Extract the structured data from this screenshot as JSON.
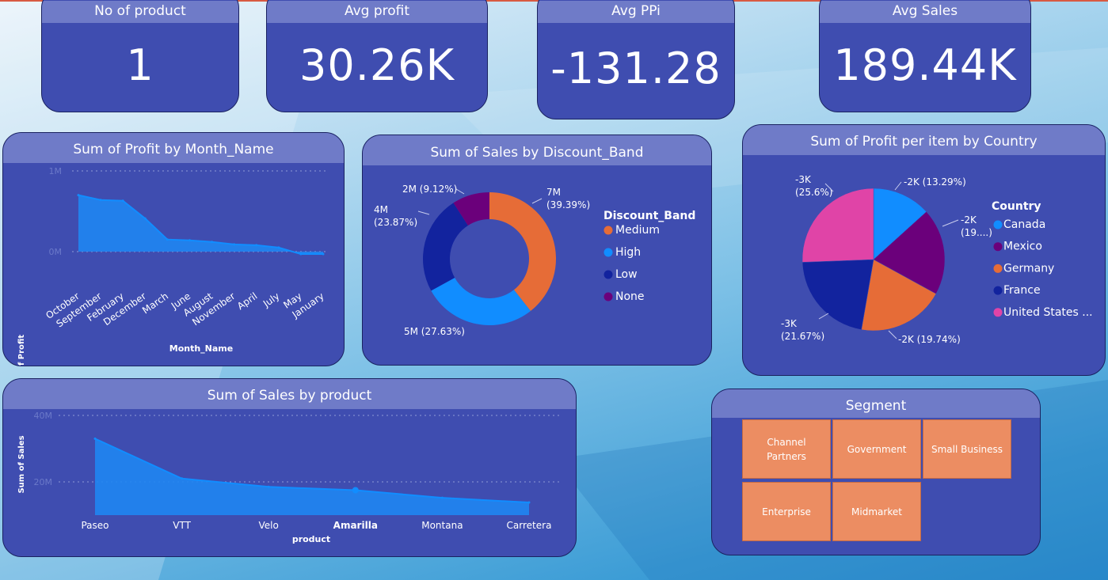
{
  "kpis": [
    {
      "title": "No of product",
      "value": "1"
    },
    {
      "title": "Avg profit",
      "value": "30.26K"
    },
    {
      "title": "Avg PPi",
      "value": "-131.28"
    },
    {
      "title": "Avg Sales",
      "value": "189.44K"
    }
  ],
  "profit_month": {
    "title": "Sum of Profit by Month_Name",
    "xlabel": "Month_Name",
    "ylabel": "Sum of Profit",
    "yticks": [
      "1M",
      "0M"
    ]
  },
  "discount": {
    "title": "Sum of Sales by Discount_Band",
    "legend_title": "Discount_Band",
    "labels": [
      "7M\n(39.39%)",
      "5M (27.63%)",
      "4M\n(23.87%)",
      "2M (9.12%)"
    ]
  },
  "country": {
    "title": "Sum of Profit per item by Country",
    "legend_title": "Country",
    "legend_items": [
      "Canada",
      "Mexico",
      "Germany",
      "France",
      "United States ..."
    ],
    "labels": [
      "-2K (13.29%)",
      "-2K\n(19....)",
      "-2K (19.74%)",
      "-3K\n(21.67%)",
      "-3K\n(25.6%)"
    ]
  },
  "product": {
    "title": "Sum of Sales by product",
    "xlabel": "product",
    "ylabel": "Sum of Sales",
    "yticks": [
      "40M",
      "20M"
    ],
    "highlighted": "Amarilla"
  },
  "segment": {
    "title": "Segment",
    "items": [
      "Channel\nPartners",
      "Government",
      "Small Business",
      "Enterprise",
      "Midmarket"
    ]
  },
  "colors": {
    "panel": "#3f4db0",
    "title_bar": "#6f7bc8",
    "area": "#1f86f2",
    "medium": "#e66c37",
    "high": "#118dff",
    "low": "#12239e",
    "none": "#6b007b",
    "us": "#e044a7",
    "segment_tile": "#ec8d62"
  },
  "chart_data": [
    {
      "type": "area",
      "title": "Sum of Profit by Month_Name",
      "xlabel": "Month_Name",
      "ylabel": "Sum of Profit",
      "categories": [
        "October",
        "September",
        "February",
        "December",
        "March",
        "June",
        "August",
        "November",
        "April",
        "July",
        "May",
        "January"
      ],
      "values": [
        0.7,
        0.64,
        0.63,
        0.41,
        0.15,
        0.14,
        0.12,
        0.09,
        0.08,
        0.05,
        -0.03,
        -0.03
      ],
      "unit": "M",
      "ylim": [
        -0.05,
        1.0
      ],
      "grid": true
    },
    {
      "type": "pie",
      "variant": "donut",
      "title": "Sum of Sales by Discount_Band",
      "legend_title": "Discount_Band",
      "legend": "right",
      "categories": [
        "Medium",
        "High",
        "Low",
        "None"
      ],
      "values": [
        7,
        5,
        4,
        2
      ],
      "percents": [
        39.39,
        27.63,
        23.87,
        9.12
      ],
      "unit": "M"
    },
    {
      "type": "pie",
      "title": "Sum of Profit per item by Country",
      "legend_title": "Country",
      "legend": "right",
      "categories": [
        "Canada",
        "Mexico",
        "Germany",
        "France",
        "United States ..."
      ],
      "values": [
        -2,
        -2,
        -2,
        -3,
        -3
      ],
      "percents": [
        13.29,
        19.7,
        19.74,
        21.67,
        25.6
      ],
      "unit": "K"
    },
    {
      "type": "area",
      "title": "Sum of Sales by product",
      "xlabel": "product",
      "ylabel": "Sum of Sales",
      "categories": [
        "Paseo",
        "VTT",
        "Velo",
        "Amarilla",
        "Montana",
        "Carretera"
      ],
      "values": [
        33,
        21,
        18.5,
        17.5,
        15.2,
        13.8
      ],
      "unit": "M",
      "ylim": [
        10,
        40
      ],
      "grid": true
    }
  ]
}
